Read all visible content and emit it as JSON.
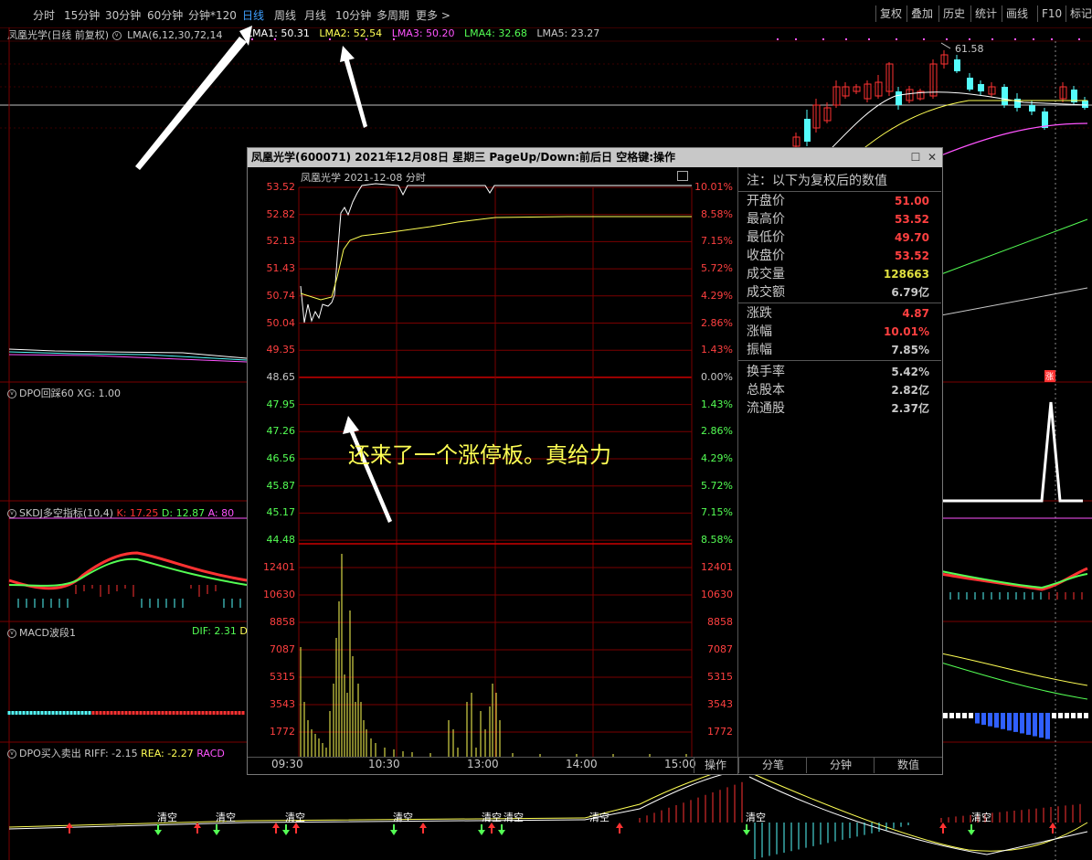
{
  "toolbar": {
    "periods": [
      "分时",
      "15分钟",
      "30分钟",
      "60分钟",
      "分钟*120",
      "日线",
      "周线",
      "月线",
      "10分钟",
      "多周期",
      "更多 >"
    ],
    "active_period": "日线",
    "right_buttons": [
      "复权",
      "叠加",
      "历史",
      "统计",
      "画线",
      "F10",
      "标记"
    ]
  },
  "main_legend": {
    "title": "凤凰光学(日线 前复权)",
    "formula": "LMA(6,12,30,72,14",
    "lma1": "LMA1: 50.31",
    "lma2": "LMA2: 52.54",
    "lma3": "LMA3: 50.20",
    "lma4": "LMA4: 32.68",
    "lma5": "LMA5: 23.27"
  },
  "high_mark": "61.58",
  "dpo_panel": {
    "label": "DPO回踩60 XG: 1.00",
    "flag": "涨"
  },
  "skdj_panel": {
    "label": "SKDJ多空指标(10,4)",
    "k": "K: 17.25",
    "d": "D: 12.87",
    "a": "A: 80"
  },
  "macd_panel": {
    "label": "MACD波段1",
    "dif": "DIF: 2.31",
    "dea": "D"
  },
  "dpobs_panel": {
    "label": "DPO买入卖出",
    "riff": "RIFF: -2.15",
    "rea": "REA: -2.27",
    "racd": "RACD",
    "signal": "清空"
  },
  "popup": {
    "title": "凤凰光学(600071)  2021年12月08日 星期三  PageUp/Down:前后日 空格键:操作",
    "chart_header": "凤凰光学   2021-12-08 分时",
    "price_labels": [
      "53.52",
      "52.82",
      "52.13",
      "51.43",
      "50.74",
      "50.04",
      "49.35",
      "48.65",
      "47.95",
      "47.26",
      "46.56",
      "45.87",
      "45.17",
      "44.48"
    ],
    "pct_labels": [
      "10.01%",
      "8.58%",
      "7.15%",
      "5.72%",
      "4.29%",
      "2.86%",
      "1.43%",
      "0.00%",
      "1.43%",
      "2.86%",
      "4.29%",
      "5.72%",
      "7.15%",
      "8.58%"
    ],
    "vol_labels": [
      "12401",
      "10630",
      "8858",
      "7087",
      "5315",
      "3543",
      "1772"
    ],
    "time_labels": [
      "09:30",
      "10:30",
      "13:00",
      "14:00",
      "15:00"
    ],
    "annotation": "还来了一个涨停板。真给力",
    "info_header": "注：以下为复权后的数值",
    "info_rows1": [
      {
        "k": "开盘价",
        "v": "51.00",
        "c": "#ff4040"
      },
      {
        "k": "最高价",
        "v": "53.52",
        "c": "#ff4040"
      },
      {
        "k": "最低价",
        "v": "49.70",
        "c": "#ff4040"
      },
      {
        "k": "收盘价",
        "v": "53.52",
        "c": "#ff4040"
      },
      {
        "k": "成交量",
        "v": "128663",
        "c": "#e0e040"
      },
      {
        "k": "成交额",
        "v": "6.79亿",
        "c": "#c8c8c8"
      }
    ],
    "info_rows2": [
      {
        "k": "涨跌",
        "v": "4.87",
        "c": "#ff4040"
      },
      {
        "k": "涨幅",
        "v": "10.01%",
        "c": "#ff4040"
      },
      {
        "k": "振幅",
        "v": "7.85%",
        "c": "#c8c8c8"
      }
    ],
    "info_rows3": [
      {
        "k": "换手率",
        "v": "5.42%",
        "c": "#c8c8c8"
      },
      {
        "k": "总股本",
        "v": "2.82亿",
        "c": "#c8c8c8"
      },
      {
        "k": "流通股",
        "v": "2.37亿",
        "c": "#c8c8c8"
      }
    ],
    "bottom_tabs": [
      "操作",
      "分笔",
      "分钟",
      "数值"
    ]
  },
  "colors": {
    "up": "#ff3232",
    "down": "#54fcfc",
    "grid": "#7a0000",
    "yellow": "#ffff54",
    "white": "#ffffff"
  }
}
